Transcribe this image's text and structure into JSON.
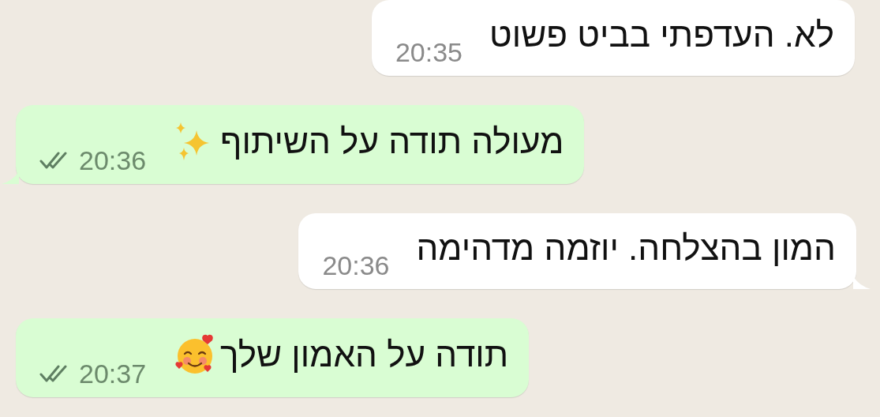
{
  "messages": [
    {
      "kind": "incoming",
      "text": "לא. העדפתי בביט פשוט",
      "time": "20:35",
      "tail": false
    },
    {
      "kind": "outgoing",
      "text": "מעולה תודה על השיתוף",
      "emoji": {
        "kind": "sparkles"
      },
      "time": "20:36",
      "read": false,
      "tail": true
    },
    {
      "kind": "incoming",
      "text": "המון בהצלחה. יוזמה מדהימה",
      "time": "20:36",
      "tail": true
    },
    {
      "kind": "outgoing",
      "text": "תודה על האמון שלך",
      "emoji": {
        "kind": "smiling-hearts"
      },
      "time": "20:37",
      "read": false,
      "tail": false
    }
  ]
}
